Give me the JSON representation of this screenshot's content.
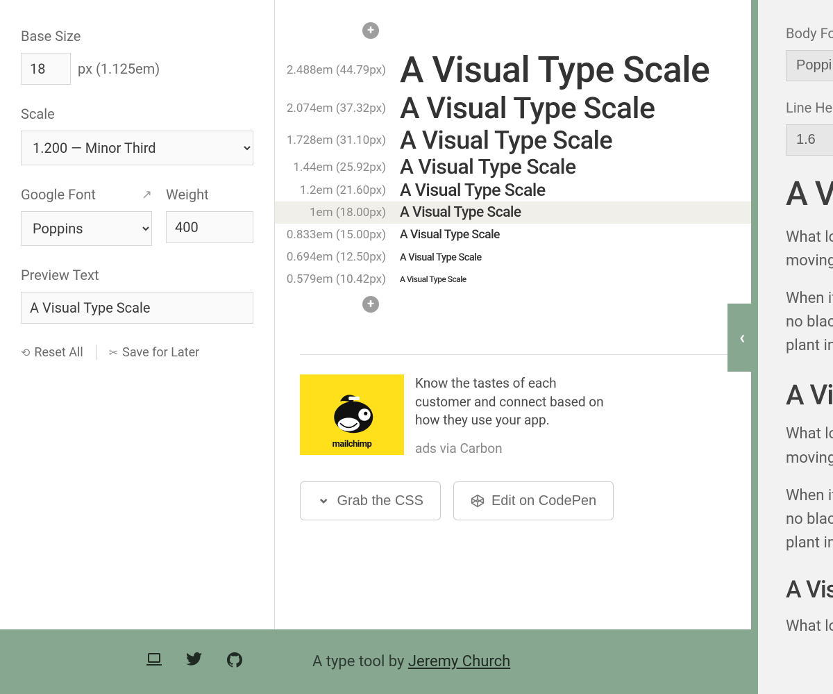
{
  "sidebar": {
    "base_size_label": "Base Size",
    "base_size_value": "18",
    "base_size_hint": "px (1.125em)",
    "scale_label": "Scale",
    "scale_value": "1.200 — Minor Third",
    "google_font_label": "Google Font",
    "google_font_value": "Poppins",
    "weight_label": "Weight",
    "weight_value": "400",
    "preview_text_label": "Preview Text",
    "preview_text_value": "A Visual Type Scale",
    "reset_label": "Reset All",
    "save_label": "Save for Later"
  },
  "scale_steps": [
    {
      "meta": "2.488em (44.79px)",
      "size": "52px",
      "text": "A Visual Type Scale",
      "highlight": false
    },
    {
      "meta": "2.074em (37.32px)",
      "size": "43px",
      "text": "A Visual Type Scale",
      "highlight": false
    },
    {
      "meta": "1.728em (31.10px)",
      "size": "36px",
      "text": "A Visual Type Scale",
      "highlight": false
    },
    {
      "meta": "1.44em (25.92px)",
      "size": "30px",
      "text": "A Visual Type Scale",
      "highlight": false
    },
    {
      "meta": "1.2em (21.60px)",
      "size": "25px",
      "text": "A Visual Type Scale",
      "highlight": false
    },
    {
      "meta": "1em (18.00px)",
      "size": "21px",
      "text": "A Visual Type Scale",
      "highlight": true
    },
    {
      "meta": "0.833em (15.00px)",
      "size": "17.5px",
      "text": "A Visual Type Scale",
      "highlight": false
    },
    {
      "meta": "0.694em (12.50px)",
      "size": "14.5px",
      "text": "A Visual Type Scale",
      "highlight": false
    },
    {
      "meta": "0.579em (10.42px)",
      "size": "12px",
      "text": "A Visual Type Scale",
      "highlight": false
    }
  ],
  "ad": {
    "text": "Know the tastes of each customer and connect based on how they use your app.",
    "via": "ads via Carbon",
    "brand": "mailchimp"
  },
  "buttons": {
    "grab_css": "Grab the CSS",
    "edit_codepen": "Edit on CodePen"
  },
  "footer": {
    "text_prefix": "A type tool by ",
    "author": "Jeremy Church"
  },
  "side": {
    "body_font_label": "Body Fo",
    "body_font_value": "Poppi",
    "line_height_label": "Line Hei",
    "line_height_value": "1.6",
    "heading1": "A Vi",
    "para1a": "What lo",
    "para1b": "moving",
    "para2a": "When it",
    "para2b": "no blac",
    "para2c": "plant in",
    "heading2": "A Vi",
    "para3a": "What lo",
    "para3b": "moving",
    "para4a": "When it",
    "para4b": "no blac",
    "para4c": "plant in",
    "heading3": "A Vis",
    "para5a": "What lo"
  },
  "panel_tab_icon": "‹"
}
